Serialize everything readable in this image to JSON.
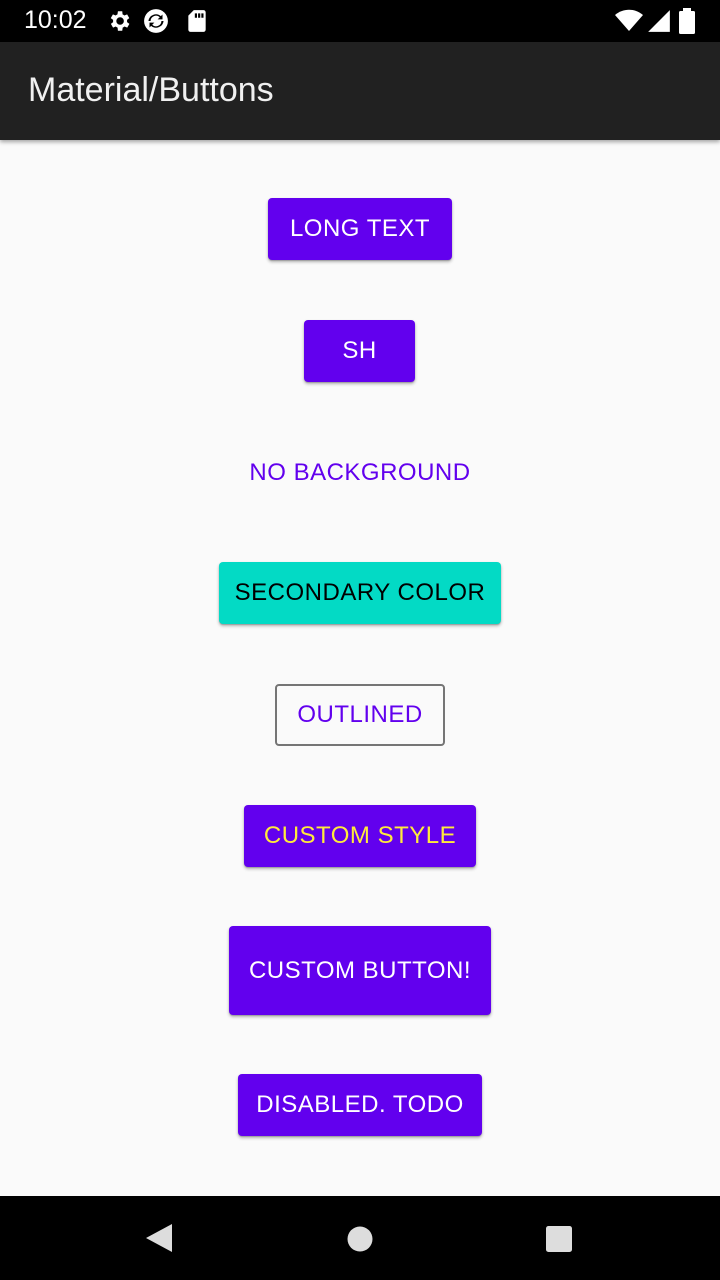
{
  "status_bar": {
    "time": "10:02",
    "left_icons": [
      "gear-icon",
      "sync-icon",
      "sd-card-icon"
    ],
    "right_icons": [
      "wifi-icon",
      "cell-signal-icon",
      "battery-icon"
    ]
  },
  "app_bar": {
    "title": "Material/Buttons"
  },
  "buttons": {
    "long_text": "LONG TEXT",
    "sh": "SH",
    "no_background": "NO BACKGROUND",
    "secondary_color": "SECONDARY COLOR",
    "outlined": "OUTLINED",
    "custom_style": "CUSTOM STYLE",
    "custom_button": "CUSTOM BUTTON!",
    "disabled_todo": "DISABLED. TODO"
  },
  "colors": {
    "primary": "#6200ee",
    "secondary": "#03dac5",
    "custom_text": "#ffeb3b",
    "app_bar": "#212121",
    "background": "#fafafa"
  },
  "nav_bar": {
    "icons": [
      "back-icon",
      "home-icon",
      "recents-icon"
    ]
  }
}
